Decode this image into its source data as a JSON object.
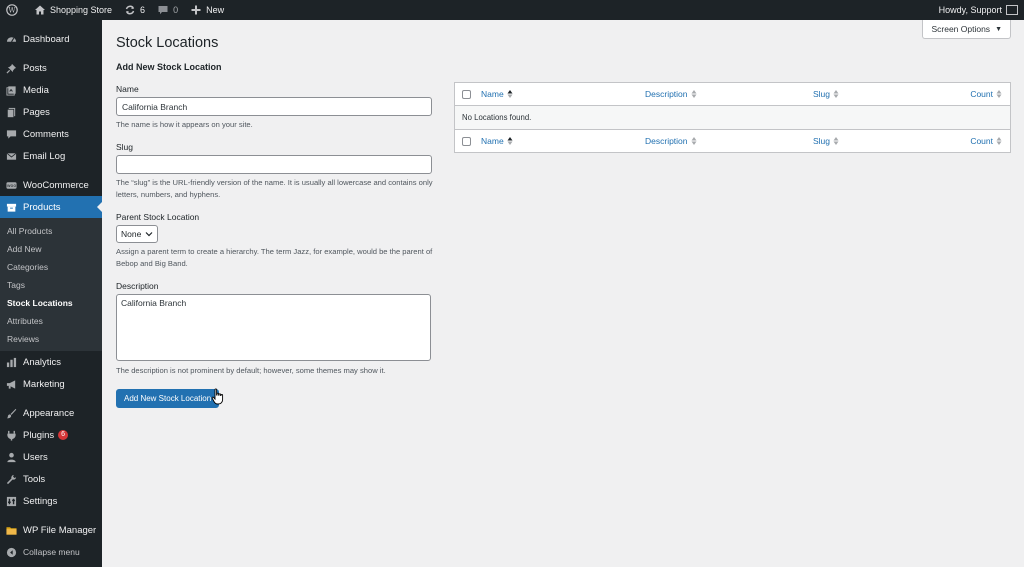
{
  "adminbar": {
    "site_name": "Shopping Store",
    "updates_count": "6",
    "comments_count": "0",
    "new_label": "New",
    "howdy": "Howdy, Support"
  },
  "sidebar": {
    "items": [
      {
        "label": "Dashboard"
      },
      {
        "label": "Posts"
      },
      {
        "label": "Media"
      },
      {
        "label": "Pages"
      },
      {
        "label": "Comments"
      },
      {
        "label": "Email Log"
      },
      {
        "label": "WooCommerce"
      },
      {
        "label": "Products"
      },
      {
        "label": "Analytics"
      },
      {
        "label": "Marketing"
      },
      {
        "label": "Appearance"
      },
      {
        "label": "Plugins",
        "badge": "6"
      },
      {
        "label": "Users"
      },
      {
        "label": "Tools"
      },
      {
        "label": "Settings"
      },
      {
        "label": "WP File Manager"
      },
      {
        "label": "Collapse menu"
      }
    ],
    "products_submenu": [
      {
        "label": "All Products"
      },
      {
        "label": "Add New"
      },
      {
        "label": "Categories"
      },
      {
        "label": "Tags"
      },
      {
        "label": "Stock Locations"
      },
      {
        "label": "Attributes"
      },
      {
        "label": "Reviews"
      }
    ]
  },
  "page": {
    "screen_options": "Screen Options",
    "title": "Stock Locations"
  },
  "form": {
    "heading": "Add New Stock Location",
    "name_label": "Name",
    "name_value": "California Branch",
    "name_help": "The name is how it appears on your site.",
    "slug_label": "Slug",
    "slug_value": "",
    "slug_help": "The “slug” is the URL-friendly version of the name. It is usually all lowercase and contains only letters, numbers, and hyphens.",
    "parent_label": "Parent Stock Location",
    "parent_value": "None",
    "parent_help": "Assign a parent term to create a hierarchy. The term Jazz, for example, would be the parent of Bebop and Big Band.",
    "desc_label": "Description",
    "desc_value": "California Branch",
    "desc_help": "The description is not prominent by default; however, some themes may show it.",
    "submit_label": "Add New Stock Location"
  },
  "table": {
    "columns": [
      "Name",
      "Description",
      "Slug",
      "Count"
    ],
    "empty_message": "No Locations found."
  },
  "colors": {
    "accent": "#2271b1",
    "sidebar_bg": "#1d2327",
    "badge": "#d63638"
  }
}
